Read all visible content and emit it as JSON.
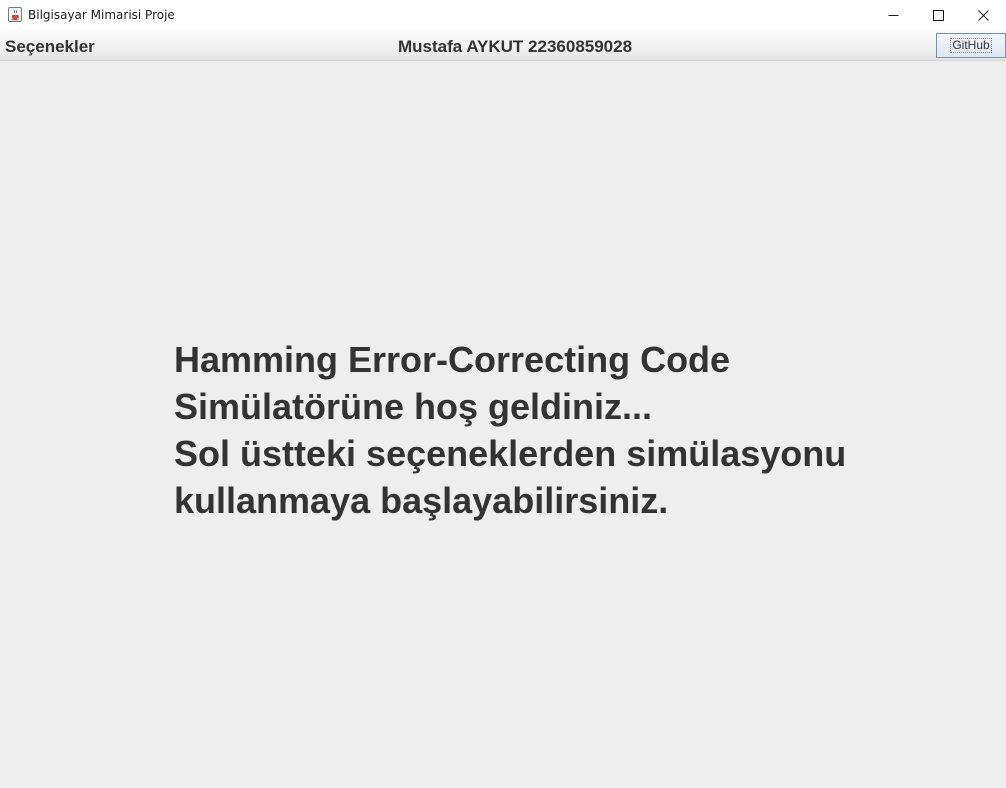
{
  "window": {
    "title": "Bilgisayar Mimarisi Proje",
    "app_icon": "java-cup-icon",
    "controls": {
      "minimize_icon": "minimize-icon",
      "maximize_icon": "maximize-icon",
      "close_icon": "close-icon"
    }
  },
  "menubar": {
    "options_label": "Seçenekler",
    "author_label": "Mustafa AYKUT 22360859028",
    "github_label": "GitHub"
  },
  "welcome": {
    "lines": [
      "Hamming Error-Correcting Code",
      "Simülatörüne hoş geldiniz...",
      "Sol üstteki seçeneklerden simülasyonu",
      "kullanmaya başlayabilirsiniz."
    ]
  },
  "colors": {
    "background": "#eeeeee",
    "text": "#333333",
    "titlebar": "#ffffff"
  }
}
